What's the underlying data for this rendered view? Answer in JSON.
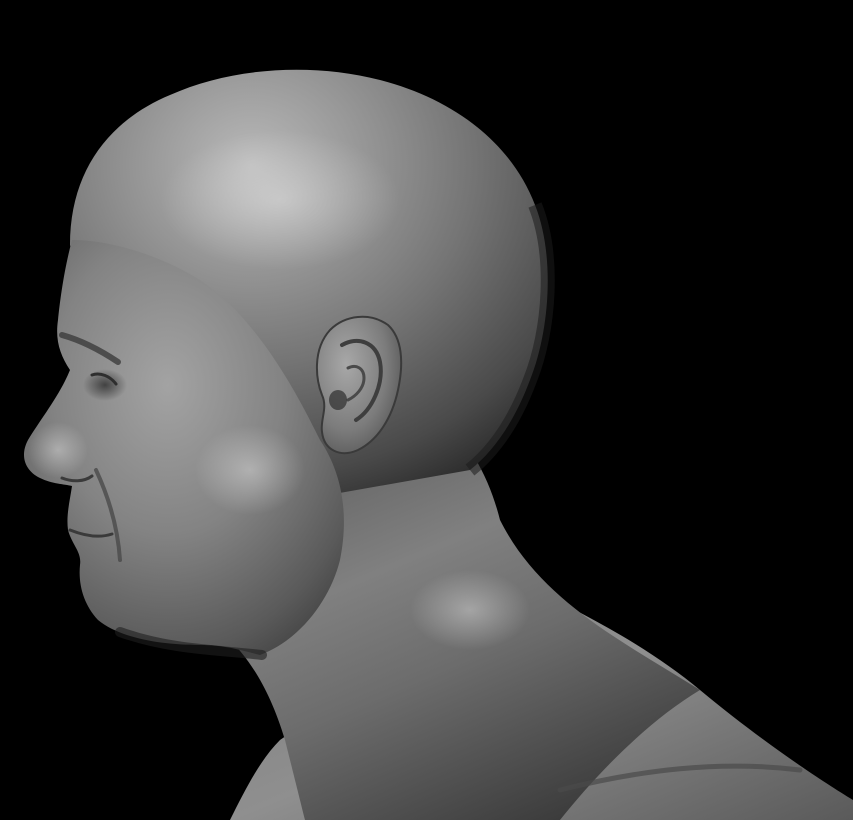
{
  "scene": {
    "background_color": "#000000",
    "material_color": "#8a8a8a",
    "subject": "sculpted-head-bust",
    "view": "left-profile"
  }
}
